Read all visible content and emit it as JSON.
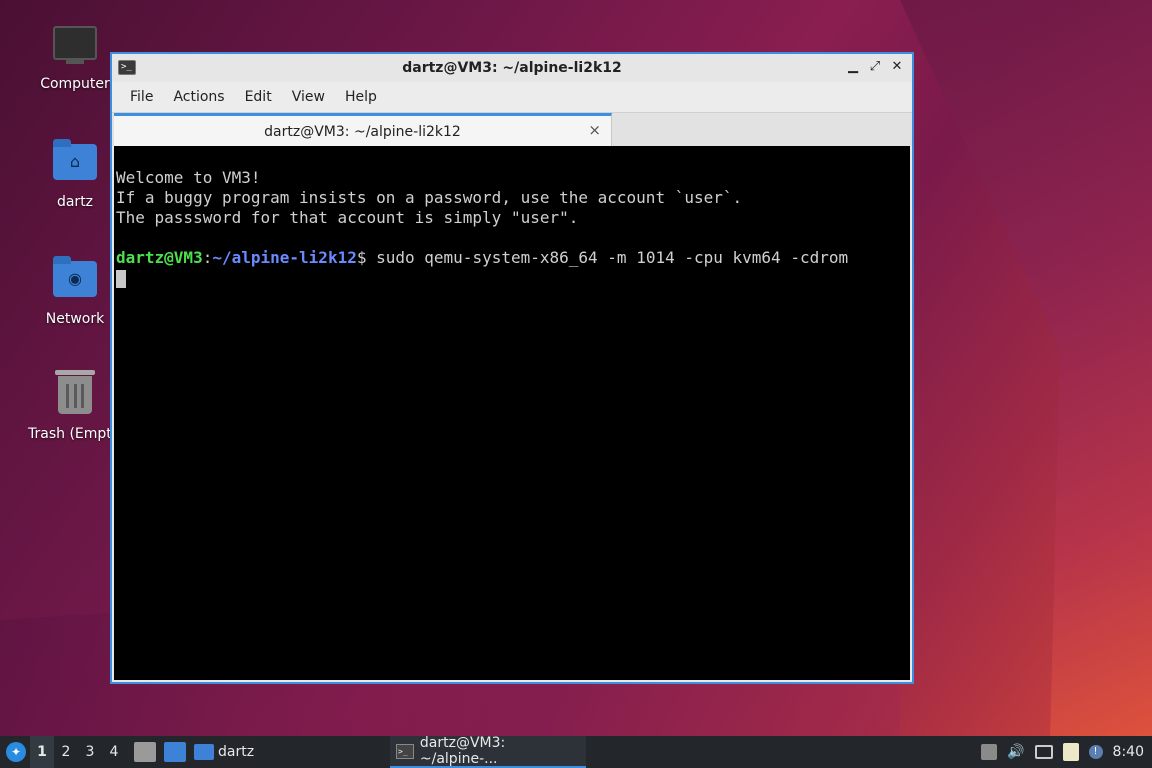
{
  "desktop": {
    "icons": [
      {
        "label": "Computer",
        "icon": "computer-icon"
      },
      {
        "label": "dartz",
        "icon": "home-folder-icon"
      },
      {
        "label": "Network",
        "icon": "network-folder-icon"
      },
      {
        "label": "Trash (Empty)",
        "icon": "trash-icon"
      }
    ]
  },
  "window": {
    "title": "dartz@VM3: ~/alpine-li2k12",
    "controls": {
      "minimize": "▁",
      "maximize": "⤢",
      "close": "✕"
    },
    "menu": [
      "File",
      "Actions",
      "Edit",
      "View",
      "Help"
    ],
    "tab": {
      "label": "dartz@VM3: ~/alpine-li2k12",
      "close": "×"
    },
    "terminal": {
      "lines": [
        "Welcome to VM3!",
        "If a buggy program insists on a password, use the account `user`.",
        "The passsword for that account is simply \"user\"."
      ],
      "prompt": {
        "user": "dartz@VM3",
        "sep": ":",
        "path": "~/alpine-li2k12",
        "symbol": "$ ",
        "command": "sudo qemu-system-x86_64 -m 1014 -cpu kvm64 -cdrom"
      }
    }
  },
  "taskbar": {
    "workspaces": [
      "1",
      "2",
      "3",
      "4"
    ],
    "active_workspace": "1",
    "folder_label": "dartz",
    "task_label": "dartz@VM3: ~/alpine-...",
    "clock": "8:40"
  },
  "colors": {
    "accent": "#3b8ee0",
    "prompt_user": "#4ce04c",
    "prompt_path": "#6a8bff"
  }
}
